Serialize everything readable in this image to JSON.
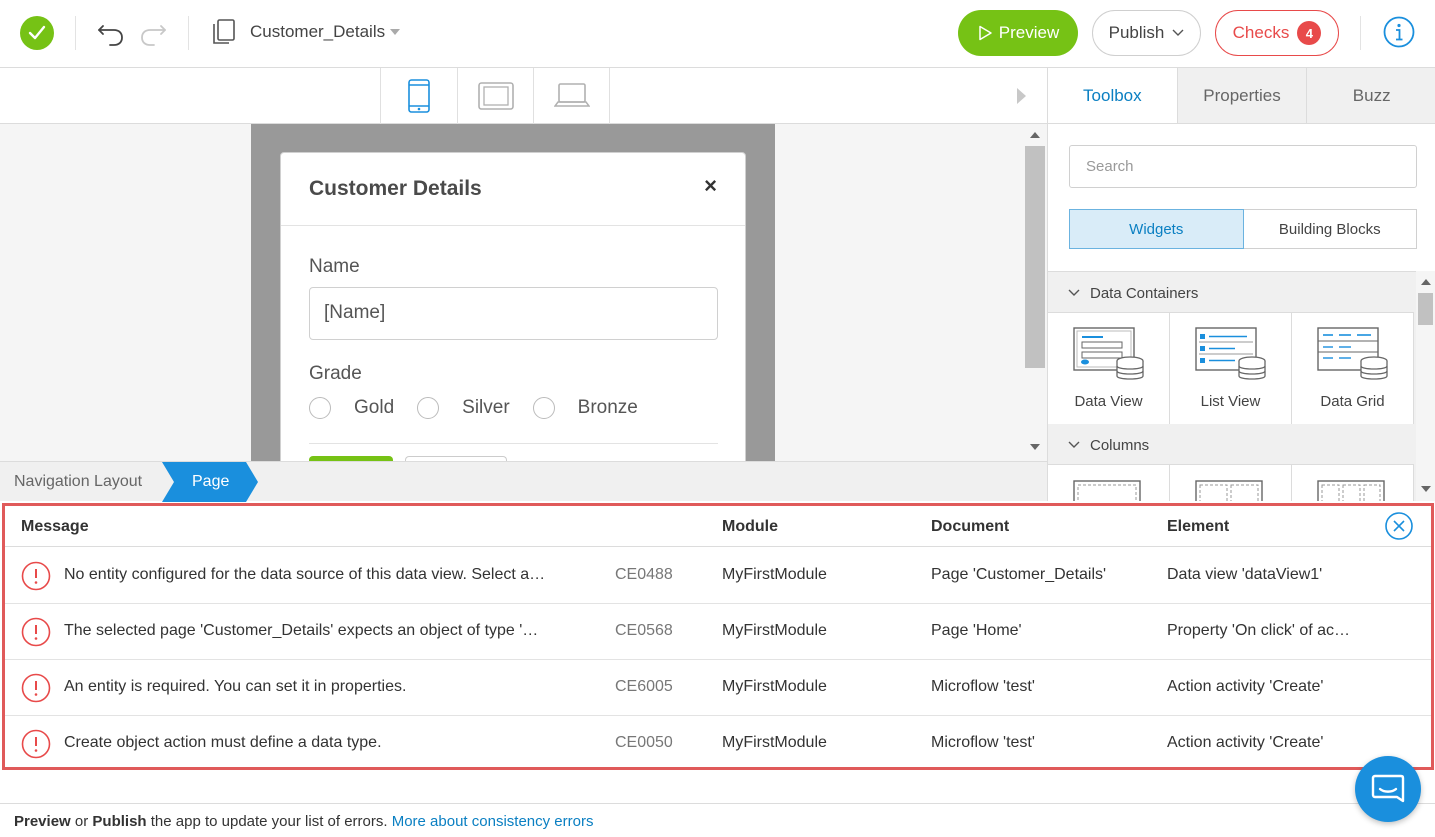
{
  "toolbar": {
    "document_name": "Customer_Details",
    "preview_label": "Preview",
    "publish_label": "Publish",
    "checks_label": "Checks",
    "checks_count": "4"
  },
  "editor_tabs": {
    "toolbox": "Toolbox",
    "properties": "Properties",
    "buzz": "Buzz"
  },
  "toolbox": {
    "search_placeholder": "Search",
    "segments": [
      "Widgets",
      "Building Blocks"
    ],
    "groups": [
      {
        "label": "Data Containers",
        "tiles": [
          "Data View",
          "List View",
          "Data Grid"
        ]
      },
      {
        "label": "Columns",
        "tiles": []
      }
    ]
  },
  "canvas": {
    "modal_title": "Customer Details",
    "close_glyph": "×",
    "name_label": "Name",
    "name_value": "[Name]",
    "grade_label": "Grade",
    "grade_options": [
      "Gold",
      "Silver",
      "Bronze"
    ]
  },
  "breadcrumb": {
    "navigation": "Navigation Layout",
    "page": "Page"
  },
  "errors": {
    "columns": {
      "message": "Message",
      "module": "Module",
      "document": "Document",
      "element": "Element"
    },
    "rows": [
      {
        "message": "No entity configured for the data source of this data view. Select a…",
        "code": "CE0488",
        "module": "MyFirstModule",
        "document": "Page 'Customer_Details'",
        "element": "Data view 'dataView1'"
      },
      {
        "message": "The selected page 'Customer_Details' expects an object of type '…",
        "code": "CE0568",
        "module": "MyFirstModule",
        "document": "Page 'Home'",
        "element": "Property 'On click' of ac…"
      },
      {
        "message": "An entity is required. You can set it in properties.",
        "code": "CE6005",
        "module": "MyFirstModule",
        "document": "Microflow 'test'",
        "element": "Action activity 'Create'"
      },
      {
        "message": "Create object action must define a data type.",
        "code": "CE0050",
        "module": "MyFirstModule",
        "document": "Microflow 'test'",
        "element": "Action activity 'Create'"
      }
    ]
  },
  "footer": {
    "preview_word": "Preview",
    "or_word": " or ",
    "publish_word": "Publish",
    "rest": " the app to update your list of errors. ",
    "link": "More about consistency errors"
  },
  "colors": {
    "green": "#76c215",
    "blue": "#0a7fc2",
    "red": "#e84a4a"
  }
}
